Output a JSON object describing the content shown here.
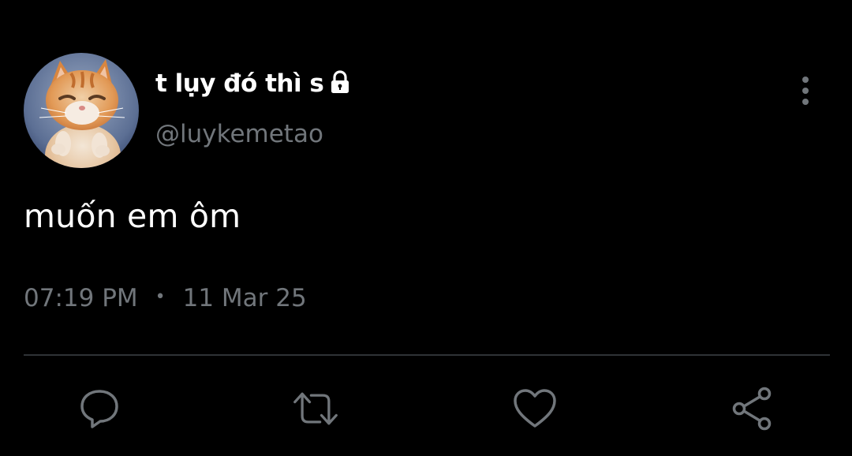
{
  "tweet": {
    "author": {
      "display_name": "t lụy đó thì s",
      "handle": "@luykemetao",
      "protected_icon": "lock-icon",
      "avatar": "avatar"
    },
    "text": "muốn em ôm",
    "time": "07:19 PM",
    "separator": "•",
    "date": "11 Mar 25"
  },
  "actions": [
    {
      "name": "reply",
      "icon": "reply-icon"
    },
    {
      "name": "retweet",
      "icon": "retweet-icon"
    },
    {
      "name": "like",
      "icon": "heart-icon"
    },
    {
      "name": "share",
      "icon": "share-icon"
    }
  ],
  "colors": {
    "background": "#000000",
    "primary_text": "#ffffff",
    "secondary_text": "#71767b",
    "divider": "#2f3336"
  }
}
